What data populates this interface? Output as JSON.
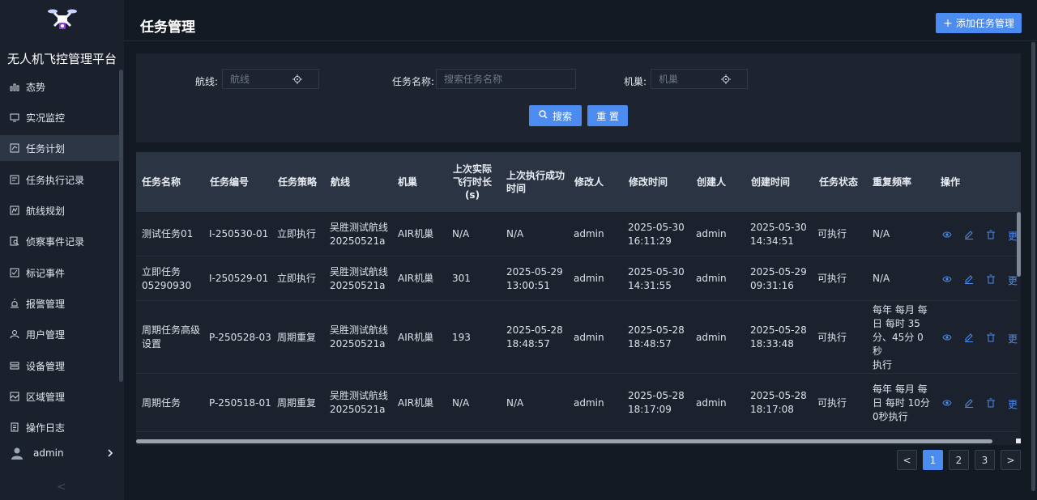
{
  "sidebar": {
    "title": "无人机飞控管理平台",
    "items": [
      {
        "label": "态势",
        "icon": "chart-icon"
      },
      {
        "label": "实况监控",
        "icon": "monitor-icon"
      },
      {
        "label": "任务计划",
        "icon": "plan-icon",
        "active": true
      },
      {
        "label": "任务执行记录",
        "icon": "record-icon"
      },
      {
        "label": "航线规划",
        "icon": "route-icon"
      },
      {
        "label": "侦察事件记录",
        "icon": "search-doc-icon"
      },
      {
        "label": "标记事件",
        "icon": "mark-icon"
      },
      {
        "label": "报警管理",
        "icon": "alarm-icon"
      },
      {
        "label": "用户管理",
        "icon": "user-icon"
      },
      {
        "label": "设备管理",
        "icon": "device-icon"
      },
      {
        "label": "区域管理",
        "icon": "area-icon"
      },
      {
        "label": "操作日志",
        "icon": "log-icon"
      }
    ],
    "user": "admin",
    "collapse_glyph": "<"
  },
  "header": {
    "title": "任务管理",
    "add_button": "添加任务管理",
    "add_glyph": "+"
  },
  "filter": {
    "route_label": "航线:",
    "route_placeholder": "航线",
    "name_label": "任务名称:",
    "name_placeholder": "搜索任务名称",
    "nest_label": "机巢:",
    "nest_placeholder": "机巢",
    "search_button": "搜索",
    "reset_button": "重 置"
  },
  "table": {
    "columns": [
      "任务名称",
      "任务编号",
      "任务策略",
      "航线",
      "机巢",
      "上次实际飞行时长(s)",
      "上次执行成功时间",
      "修改人",
      "修改时间",
      "创建人",
      "创建时间",
      "任务状态",
      "重复频率",
      "操作"
    ],
    "column_lines": {
      "c5a": "上次实际",
      "c5b": "飞行时长",
      "c5c": "(s)",
      "c6a": "上次执行成功",
      "c6b": "时间"
    },
    "rows": [
      {
        "name": "测试任务01",
        "code": "I-250530-01",
        "strategy": "立即执行",
        "route": "吴胜测试航线20250521a",
        "nest": "AIR机巢",
        "duration": "N/A",
        "last_success": "N/A",
        "modifier": "admin",
        "modified": "2025-05-30 16:11:29",
        "creator": "admin",
        "created": "2025-05-30 14:34:51",
        "status": "可执行",
        "freq": "N/A"
      },
      {
        "name": "立即任务05290930",
        "code": "I-250529-01",
        "strategy": "立即执行",
        "route": "吴胜测试航线20250521a",
        "nest": "AIR机巢",
        "duration": "301",
        "last_success": "2025-05-29 13:00:51",
        "modifier": "admin",
        "modified": "2025-05-30 14:31:55",
        "creator": "admin",
        "created": "2025-05-29 09:31:16",
        "status": "可执行",
        "freq": "N/A"
      },
      {
        "name": "周期任务高级设置",
        "code": "P-250528-03",
        "strategy": "周期重复",
        "route": "吴胜测试航线20250521a",
        "nest": "AIR机巢",
        "duration": "193",
        "last_success": "2025-05-28 18:48:57",
        "modifier": "admin",
        "modified": "2025-05-28 18:48:57",
        "creator": "admin",
        "created": "2025-05-28 18:33:48",
        "status": "可执行",
        "freq": "每年 每月 每日 每时 35分、45分 0秒执行"
      },
      {
        "name": "周期任务",
        "code": "P-250518-01",
        "strategy": "周期重复",
        "route": "吴胜测试航线20250521a",
        "nest": "AIR机巢",
        "duration": "N/A",
        "last_success": "N/A",
        "modifier": "admin",
        "modified": "2025-05-28 18:17:09",
        "creator": "admin",
        "created": "2025-05-28 18:17:08",
        "status": "可执行",
        "freq": "每年 每月 每日 每时 10分 0秒执行"
      }
    ],
    "row_lines": [
      {
        "name": [
          "测试任务01"
        ],
        "route": [
          "吴胜测试航线",
          "20250521a"
        ],
        "ls": [
          "N/A"
        ],
        "mod": [
          "2025-05-30",
          "16:11:29"
        ],
        "cr": [
          "2025-05-30",
          "14:34:51"
        ],
        "fq": [
          "N/A"
        ]
      },
      {
        "name": [
          "立即任务",
          "05290930"
        ],
        "route": [
          "吴胜测试航线",
          "20250521a"
        ],
        "ls": [
          "2025-05-29",
          "13:00:51"
        ],
        "mod": [
          "2025-05-30",
          "14:31:55"
        ],
        "cr": [
          "2025-05-29",
          "09:31:16"
        ],
        "fq": [
          "N/A"
        ]
      },
      {
        "name": [
          "周期任务高级",
          "设置"
        ],
        "route": [
          "吴胜测试航线",
          "20250521a"
        ],
        "ls": [
          "2025-05-28",
          "18:48:57"
        ],
        "mod": [
          "2025-05-28",
          "18:48:57"
        ],
        "cr": [
          "2025-05-28",
          "18:33:48"
        ],
        "fq": [
          "每年 每月 每",
          "日 每时 35",
          "分、45分 0秒",
          "执行"
        ]
      },
      {
        "name": [
          "周期任务"
        ],
        "route": [
          "吴胜测试航线",
          "20250521a"
        ],
        "ls": [
          "N/A"
        ],
        "mod": [
          "2025-05-28",
          "18:17:09"
        ],
        "cr": [
          "2025-05-28",
          "18:17:08"
        ],
        "fq": [
          "每年 每月 每",
          "日 每时 10分",
          "0秒执行"
        ]
      }
    ],
    "op_icons": [
      "eye-icon",
      "edit-icon",
      "delete-icon"
    ],
    "op_clipped": "更"
  },
  "pagination": {
    "prev": "<",
    "pages": [
      "1",
      "2",
      "3"
    ],
    "current": "1",
    "next": ">"
  },
  "colors": {
    "accent": "#4c8cf0",
    "background": "#141a23",
    "sidebar": "#1a212c",
    "table_header": "#2a3442"
  }
}
